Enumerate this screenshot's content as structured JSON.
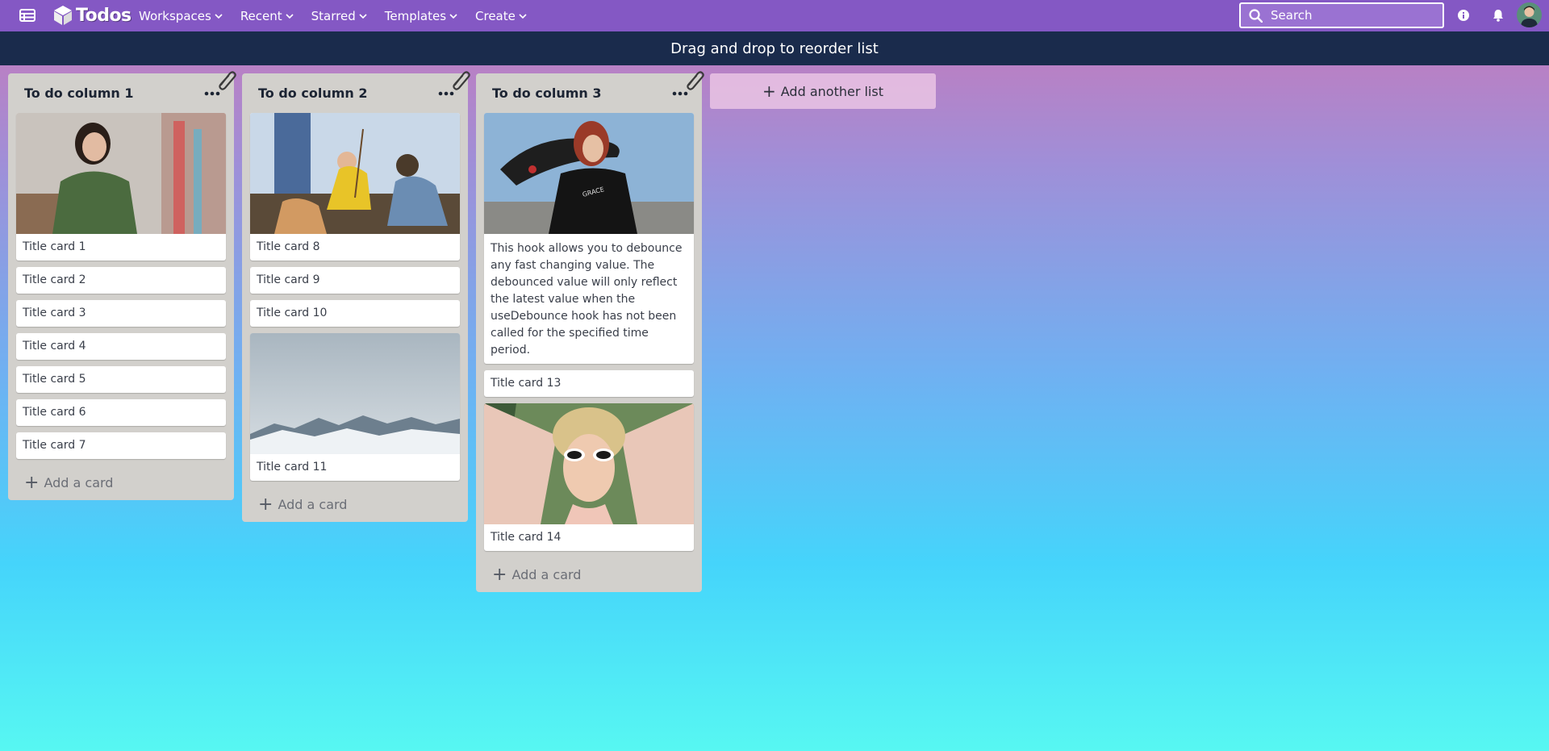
{
  "nav": {
    "brand": "Todos",
    "items": [
      {
        "label": "Workspaces"
      },
      {
        "label": "Recent"
      },
      {
        "label": "Starred"
      },
      {
        "label": "Templates"
      },
      {
        "label": "Create"
      }
    ],
    "search_placeholder": "Search"
  },
  "banner": {
    "text": "Drag and drop to reorder list"
  },
  "columns": [
    {
      "title": "To do column 1",
      "image_card": {
        "title": "Title card 1",
        "image": "woman-in-green-shirt-photo"
      },
      "cards": [
        "Title card 2",
        "Title card 3",
        "Title card 4",
        "Title card 5",
        "Title card 6",
        "Title card 7"
      ],
      "add_card_label": "Add a card"
    },
    {
      "title": "To do column 2",
      "image_card": {
        "title": "Title card 8",
        "image": "group-planting-tree-photo"
      },
      "cards": [
        "Title card 9",
        "Title card 10"
      ],
      "image_card_2": {
        "title": "Title card 11",
        "image": "snowy-mountains-photo"
      },
      "add_card_label": "Add a card"
    },
    {
      "title": "To do column 3",
      "image_card": {
        "image": "woman-with-skateboard-photo",
        "text": "This hook allows you to debounce any fast changing value. The debounced value will only reflect the latest value when the useDebounce hook has not been called for the specified time period.",
        "shirt_text": "GRACE"
      },
      "cards": [
        "Title card 13"
      ],
      "image_card_2": {
        "title": "Title card 14",
        "image": "woman-with-sunglasses-photo"
      },
      "add_card_label": "Add a card"
    }
  ],
  "add_list_label": "Add another list",
  "colors": {
    "nav_bg": "#8458c4",
    "banner_bg": "#1a2b4c",
    "column_bg": "#d2d0cc"
  }
}
